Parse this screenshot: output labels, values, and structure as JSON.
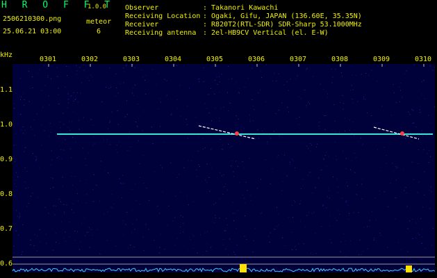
{
  "app": {
    "name": "H R O F F T",
    "version": "1.0.0"
  },
  "file": {
    "name": "2506210300.png",
    "datetime": "25.06.21 03:00"
  },
  "meteor": {
    "label": "meteor",
    "count": "6"
  },
  "meta": [
    {
      "key": "Observer",
      "value": ": Takanori Kawachi"
    },
    {
      "key": "Receiving Location",
      "value": ": Ogaki, Gifu, JAPAN (136.60E, 35.35N)"
    },
    {
      "key": "Receiver",
      "value": ": R820T2(RTL-SDR) SDR-Sharp 53.1000MHz"
    },
    {
      "key": "Receiving antenna",
      "value": ": 2el-HB9CV Vertical (el. E-W)"
    }
  ],
  "axis": {
    "unit": "kHz",
    "x_ticks": [
      "0301",
      "0302",
      "0303",
      "0304",
      "0305",
      "0306",
      "0307",
      "0308",
      "0309",
      "0310"
    ],
    "y_ticks": [
      "1.1",
      "1.0",
      "0.9",
      "0.8",
      "0.7",
      "0.6"
    ]
  },
  "colors": {
    "background": "#000000",
    "spectrogram_bg": "#00003a",
    "carrier": "#00e0ff",
    "meteor_echo": "#ff6060",
    "label": "#f2f200"
  }
}
